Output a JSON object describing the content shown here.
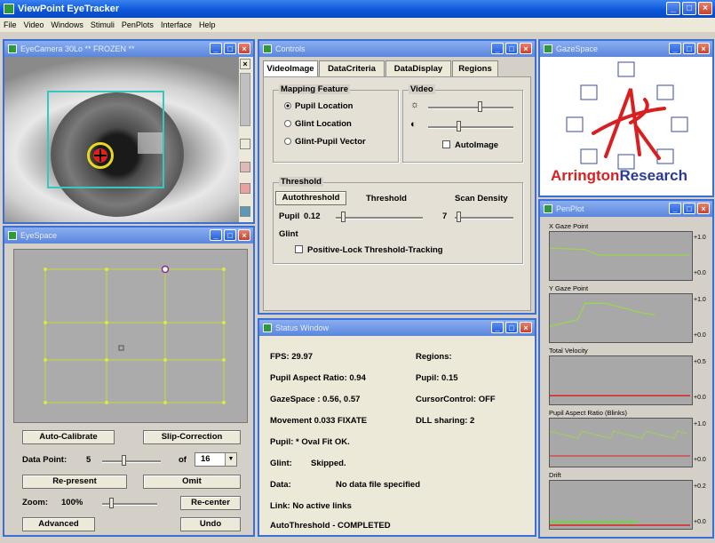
{
  "app": {
    "title": "ViewPoint EyeTracker"
  },
  "menu": [
    "File",
    "Video",
    "Windows",
    "Stimuli",
    "PenPlots",
    "Interface",
    "Help"
  ],
  "windows": {
    "eyecamera": {
      "title": "EyeCamera 30Lo ** FROZEN **"
    },
    "eyespace": {
      "title": "EyeSpace"
    },
    "controls": {
      "title": "Controls"
    },
    "gazespace": {
      "title": "GazeSpace"
    },
    "penplot": {
      "title": "PenPlot"
    },
    "status": {
      "title": "Status Window"
    }
  },
  "eyespace": {
    "auto_calibrate": "Auto-Calibrate",
    "slip_correction": "Slip-Correction",
    "data_point_label": "Data Point:",
    "data_point_value": "5",
    "of_label": "of",
    "of_value": "16",
    "re_present": "Re-present",
    "omit": "Omit",
    "zoom_label": "Zoom:",
    "zoom_value": "100%",
    "re_center": "Re-center",
    "advanced": "Advanced",
    "undo": "Undo"
  },
  "controls": {
    "tabs": [
      "VideoImage",
      "DataCriteria",
      "DataDisplay",
      "Regions"
    ],
    "mapping_feature": "Mapping Feature",
    "mapping_options": [
      "Pupil Location",
      "Glint Location",
      "Glint-Pupil Vector"
    ],
    "mapping_selected": 0,
    "video": "Video",
    "autoimage": "AutoImage",
    "threshold_group": "Threshold",
    "autothreshold_button": "Autothreshold",
    "threshold_header": "Threshold",
    "scan_density_header": "Scan Density",
    "pupil_label": "Pupil",
    "pupil_threshold": "0.12",
    "scan_density_value": "7",
    "glint_label": "Glint",
    "positive_lock": "Positive-Lock Threshold-Tracking"
  },
  "gazespace": {
    "logo_a": "Arrington",
    "logo_b": "Research"
  },
  "penplot": {
    "plots": [
      {
        "title": "X Gaze Point",
        "top_tick": "+1.0",
        "bottom_tick": "+0.0"
      },
      {
        "title": "Y Gaze Point",
        "top_tick": "+1.0",
        "bottom_tick": "+0.0"
      },
      {
        "title": "Total Velocity",
        "top_tick": "+0.5",
        "bottom_tick": "+0.0"
      },
      {
        "title": "Pupil Aspect Ratio (Blinks)",
        "top_tick": "+1.0",
        "bottom_tick": "+0.0"
      },
      {
        "title": "Drift",
        "top_tick": "+0.2",
        "bottom_tick": "+0.0"
      }
    ]
  },
  "status": {
    "fps": "FPS:   29.97",
    "regions": "Regions:",
    "pupil_aspect": "Pupil Aspect Ratio:  0.94",
    "pupil_val": "Pupil:   0.15",
    "gazespace": "GazeSpace :  0.56,  0.57",
    "cursor_control": "CursorControl:  OFF",
    "movement": "Movement  0.033 FIXATE",
    "dll_sharing": "DLL sharing: 2",
    "pupil_fit": "Pupil:   * Oval Fit OK.",
    "glint_label": "Glint:",
    "glint_value": "Skipped.",
    "data_label": "Data:",
    "data_value": "No data file specified",
    "link": "Link:  No active links",
    "autothreshold": "AutoThreshold - COMPLETED"
  },
  "colors": {
    "titlebar": "#0a55d8",
    "subtitle": "#5a86dc",
    "grid": "#c8d83a",
    "plot_line": "#9ad84a",
    "red": "#e02020"
  }
}
